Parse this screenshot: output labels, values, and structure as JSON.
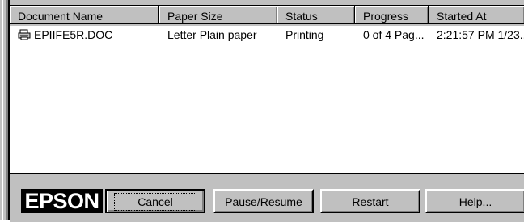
{
  "columns": [
    {
      "label": "Document Name"
    },
    {
      "label": "Paper Size"
    },
    {
      "label": "Status"
    },
    {
      "label": "Progress"
    },
    {
      "label": "Started At"
    }
  ],
  "jobs": [
    {
      "document_name": "EPIIFE5R.DOC",
      "icon": "document-icon",
      "paper_size": "Letter Plain paper",
      "status": "Printing",
      "progress": "0 of 4 Pag...",
      "started_at": "2:21:57 PM 1/23..."
    }
  ],
  "brand": {
    "logo_text": "EPSON"
  },
  "buttons": {
    "cancel": "Cancel",
    "pause_resume": "Pause/Resume",
    "restart": "Restart",
    "help": "Help..."
  },
  "colors": {
    "face": "#c0c0c0",
    "logo_bg": "#000000",
    "logo_text": "#ffffff"
  }
}
